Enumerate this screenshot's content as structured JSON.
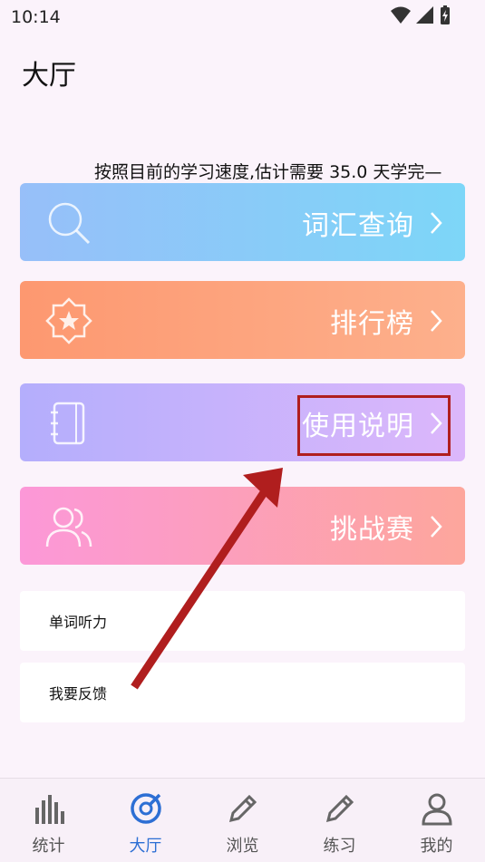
{
  "status": {
    "time": "10:14"
  },
  "header": {
    "title": "大厅"
  },
  "marquee": {
    "text": "按照目前的学习速度,估计需要 35.0 天学完—"
  },
  "cards": [
    {
      "label": "词汇查询",
      "icon": "search-icon"
    },
    {
      "label": "排行榜",
      "icon": "star-badge-icon"
    },
    {
      "label": "使用说明",
      "icon": "notebook-icon"
    },
    {
      "label": "挑战赛",
      "icon": "users-icon"
    }
  ],
  "list": [
    {
      "label": "单词听力"
    },
    {
      "label": "我要反馈"
    }
  ],
  "nav": [
    {
      "label": "统计",
      "icon": "bar-chart-icon",
      "active": false
    },
    {
      "label": "大厅",
      "icon": "compass-icon",
      "active": true
    },
    {
      "label": "浏览",
      "icon": "pencil-icon",
      "active": false
    },
    {
      "label": "练习",
      "icon": "pencil-icon",
      "active": false
    },
    {
      "label": "我的",
      "icon": "person-icon",
      "active": false
    }
  ],
  "colors": {
    "highlight": "#b01e1e",
    "arrow": "#b01e1e",
    "active_nav": "#2d6fd4"
  }
}
